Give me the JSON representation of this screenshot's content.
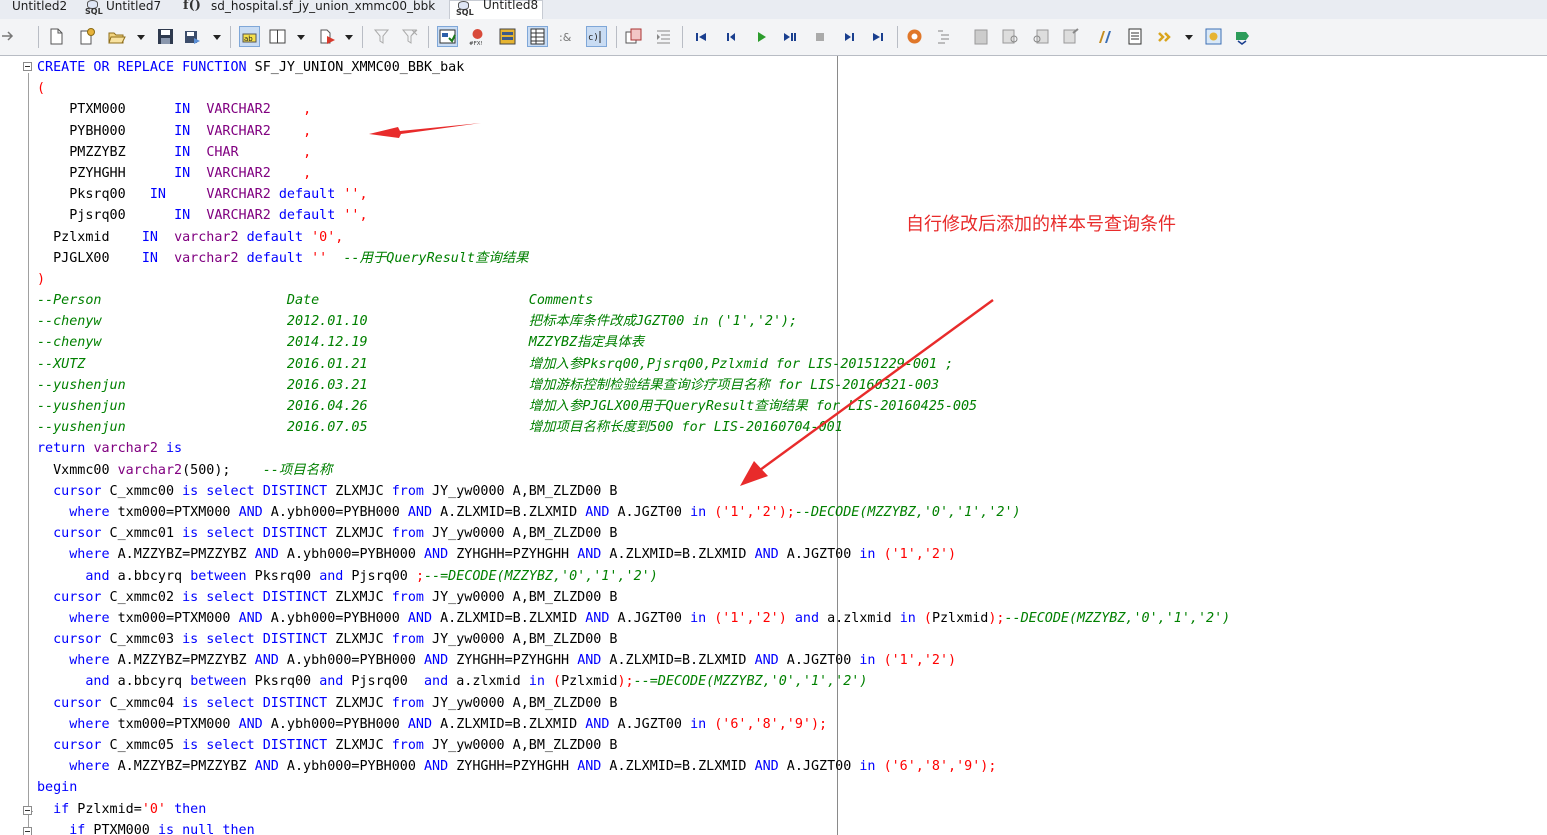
{
  "tabs": [
    {
      "label": "Untitled2",
      "icon": "untitled-tab-icon"
    },
    {
      "label": "Untitled7",
      "icon": "sql-file-icon",
      "icon_text": "SQL"
    },
    {
      "label": "sd_hospital.sf_jy_union_xmmc00_bbk",
      "icon": "function-icon",
      "icon_text": "f()"
    },
    {
      "label": "Untitled8",
      "icon": "sql-file-icon",
      "icon_text": "SQL",
      "active": true
    }
  ],
  "toolbar_icons": [
    "back-arrow-icon",
    "new-file-icon",
    "new-with-template-icon",
    "open-file-icon",
    "save-icon",
    "save-as-icon",
    "text-highlight-icon",
    "split-view-icon",
    "run-menu-icon",
    "filter-icon",
    "filter-clear-icon",
    "autocommit-icon",
    "debug-icon",
    "grid-icon",
    "table-icon",
    "and-icon",
    "step-icon",
    "copy-icon",
    "indent-icon",
    "first-record-icon",
    "prev-record-icon",
    "play-icon",
    "next-icon",
    "stop-icon",
    "step-into-icon",
    "last-record-icon",
    "execute-icon",
    "outline-icon",
    "print-preview-icon",
    "find-icon",
    "find-next-icon",
    "compile-icon",
    "beautify-icon",
    "window-list-icon",
    "more-options-icon",
    "plan-icon",
    "commit-icon"
  ],
  "editor": {
    "lines": [
      [
        [
          "k",
          "CREATE OR REPLACE FUNCTION"
        ],
        [
          "x",
          " SF_JY_UNION_XMMC00_BBK_bak"
        ]
      ],
      [
        [
          "p",
          "("
        ]
      ],
      [
        [
          "x",
          "    PTXM000      "
        ],
        [
          "k",
          "IN"
        ],
        [
          "x",
          "  "
        ],
        [
          "t",
          "VARCHAR2"
        ],
        [
          "x",
          "    "
        ],
        [
          "s",
          ","
        ]
      ],
      [
        [
          "x",
          "    PYBH000      "
        ],
        [
          "k",
          "IN"
        ],
        [
          "x",
          "  "
        ],
        [
          "t",
          "VARCHAR2"
        ],
        [
          "x",
          "    "
        ],
        [
          "s",
          ","
        ]
      ],
      [
        [
          "x",
          "    PMZZYBZ      "
        ],
        [
          "k",
          "IN"
        ],
        [
          "x",
          "  "
        ],
        [
          "t",
          "CHAR"
        ],
        [
          "x",
          "        "
        ],
        [
          "s",
          ","
        ]
      ],
      [
        [
          "x",
          "    PZYHGHH      "
        ],
        [
          "k",
          "IN"
        ],
        [
          "x",
          "  "
        ],
        [
          "t",
          "VARCHAR2"
        ],
        [
          "x",
          "    "
        ],
        [
          "s",
          ","
        ]
      ],
      [
        [
          "x",
          "    Pksrq00   "
        ],
        [
          "k",
          "IN"
        ],
        [
          "x",
          "     "
        ],
        [
          "t",
          "VARCHAR2"
        ],
        [
          "x",
          " "
        ],
        [
          "k",
          "default"
        ],
        [
          "x",
          " "
        ],
        [
          "s",
          "'',"
        ]
      ],
      [
        [
          "x",
          "    Pjsrq00      "
        ],
        [
          "k",
          "IN"
        ],
        [
          "x",
          "  "
        ],
        [
          "t",
          "VARCHAR2"
        ],
        [
          "x",
          " "
        ],
        [
          "k",
          "default"
        ],
        [
          "x",
          " "
        ],
        [
          "s",
          "'',"
        ]
      ],
      [
        [
          "x",
          "  Pzlxmid    "
        ],
        [
          "k",
          "IN"
        ],
        [
          "x",
          "  "
        ],
        [
          "t",
          "varchar2"
        ],
        [
          "x",
          " "
        ],
        [
          "k",
          "default"
        ],
        [
          "x",
          " "
        ],
        [
          "s",
          "'0',"
        ]
      ],
      [
        [
          "x",
          "  PJGLX00    "
        ],
        [
          "k",
          "IN"
        ],
        [
          "x",
          "  "
        ],
        [
          "t",
          "varchar2"
        ],
        [
          "x",
          " "
        ],
        [
          "k",
          "default"
        ],
        [
          "x",
          " "
        ],
        [
          "s",
          "''"
        ],
        [
          "x",
          "  "
        ],
        [
          "c",
          "--用于QueryResult查询结果"
        ]
      ],
      [
        [
          "p",
          ")"
        ]
      ],
      [
        [
          "c",
          "--Person                       Date                          Comments"
        ]
      ],
      [
        [
          "c",
          "--chenyw                       2012.01.10                    把标本库条件改成JGZT00 in ('1','2');"
        ]
      ],
      [
        [
          "c",
          "--chenyw                       2014.12.19                    MZZYBZ指定具体表"
        ]
      ],
      [
        [
          "c",
          "--XUTZ                         2016.01.21                    增加入参Pksrq00,Pjsrq00,Pzlxmid for LIS-20151229-001 ;"
        ]
      ],
      [
        [
          "c",
          "--yushenjun                    2016.03.21                    增加游标控制检验结果查询诊疗项目名称 for LIS-20160321-003"
        ]
      ],
      [
        [
          "c",
          "--yushenjun                    2016.04.26                    增加入参PJGLX00用于QueryResult查询结果 for LIS-20160425-005"
        ]
      ],
      [
        [
          "c",
          "--yushenjun                    2016.07.05                    增加项目名称长度到500 for LIS-20160704-001"
        ]
      ],
      [
        [
          "k",
          "return"
        ],
        [
          "x",
          " "
        ],
        [
          "t",
          "varchar2"
        ],
        [
          "x",
          " "
        ],
        [
          "k",
          "is"
        ]
      ],
      [
        [
          "x",
          "  Vxmmc00 "
        ],
        [
          "t",
          "varchar2"
        ],
        [
          "x",
          "(500);    "
        ],
        [
          "c",
          "--项目名称"
        ]
      ],
      [
        [
          "x",
          "  "
        ],
        [
          "k",
          "cursor"
        ],
        [
          "x",
          " C_xmmc00 "
        ],
        [
          "k",
          "is select DISTINCT"
        ],
        [
          "x",
          " ZLXMJC "
        ],
        [
          "k",
          "from"
        ],
        [
          "x",
          " JY_yw0000 A,BM_ZLZD00 B"
        ]
      ],
      [
        [
          "x",
          "    "
        ],
        [
          "k",
          "where"
        ],
        [
          "x",
          " txm000=PTXM000 "
        ],
        [
          "k",
          "AND"
        ],
        [
          "x",
          " A.ybh000=PYBH000 "
        ],
        [
          "k",
          "AND"
        ],
        [
          "x",
          " A.ZLXMID=B.ZLXMID "
        ],
        [
          "k",
          "AND"
        ],
        [
          "x",
          " A.JGZT00 "
        ],
        [
          "k",
          "in"
        ],
        [
          "x",
          " "
        ],
        [
          "s",
          "('1','2');"
        ],
        [
          "c",
          "--DECODE(MZZYBZ,'0','1','2')"
        ]
      ],
      [
        [
          "x",
          "  "
        ],
        [
          "k",
          "cursor"
        ],
        [
          "x",
          " C_xmmc01 "
        ],
        [
          "k",
          "is select DISTINCT"
        ],
        [
          "x",
          " ZLXMJC "
        ],
        [
          "k",
          "from"
        ],
        [
          "x",
          " JY_yw0000 A,BM_ZLZD00 B"
        ]
      ],
      [
        [
          "x",
          "    "
        ],
        [
          "k",
          "where"
        ],
        [
          "x",
          " A.MZZYBZ=PMZZYBZ "
        ],
        [
          "k",
          "AND"
        ],
        [
          "x",
          " A.ybh000=PYBH000 "
        ],
        [
          "k",
          "AND"
        ],
        [
          "x",
          " ZYHGHH=PZYHGHH "
        ],
        [
          "k",
          "AND"
        ],
        [
          "x",
          " A.ZLXMID=B.ZLXMID "
        ],
        [
          "k",
          "AND"
        ],
        [
          "x",
          " A.JGZT00 "
        ],
        [
          "k",
          "in"
        ],
        [
          "x",
          " "
        ],
        [
          "s",
          "('1','2')"
        ]
      ],
      [
        [
          "x",
          "      "
        ],
        [
          "k",
          "and"
        ],
        [
          "x",
          " a.bbcyrq "
        ],
        [
          "k",
          "between"
        ],
        [
          "x",
          " Pksrq00 "
        ],
        [
          "k",
          "and"
        ],
        [
          "x",
          " Pjsrq00 "
        ],
        [
          "s",
          ";"
        ],
        [
          "c",
          "--=DECODE(MZZYBZ,'0','1','2')"
        ]
      ],
      [
        [
          "x",
          "  "
        ],
        [
          "k",
          "cursor"
        ],
        [
          "x",
          " C_xmmc02 "
        ],
        [
          "k",
          "is select DISTINCT"
        ],
        [
          "x",
          " ZLXMJC "
        ],
        [
          "k",
          "from"
        ],
        [
          "x",
          " JY_yw0000 A,BM_ZLZD00 B"
        ]
      ],
      [
        [
          "x",
          "    "
        ],
        [
          "k",
          "where"
        ],
        [
          "x",
          " txm000=PTXM000 "
        ],
        [
          "k",
          "AND"
        ],
        [
          "x",
          " A.ybh000=PYBH000 "
        ],
        [
          "k",
          "AND"
        ],
        [
          "x",
          " A.ZLXMID=B.ZLXMID "
        ],
        [
          "k",
          "AND"
        ],
        [
          "x",
          " A.JGZT00 "
        ],
        [
          "k",
          "in"
        ],
        [
          "x",
          " "
        ],
        [
          "s",
          "('1','2')"
        ],
        [
          "x",
          " "
        ],
        [
          "k",
          "and"
        ],
        [
          "x",
          " a.zlxmid "
        ],
        [
          "k",
          "in"
        ],
        [
          "x",
          " "
        ],
        [
          "s",
          "("
        ],
        [
          "x",
          "Pzlxmid"
        ],
        [
          "s",
          ");"
        ],
        [
          "c",
          "--DECODE(MZZYBZ,'0','1','2')"
        ]
      ],
      [
        [
          "x",
          "  "
        ],
        [
          "k",
          "cursor"
        ],
        [
          "x",
          " C_xmmc03 "
        ],
        [
          "k",
          "is select DISTINCT"
        ],
        [
          "x",
          " ZLXMJC "
        ],
        [
          "k",
          "from"
        ],
        [
          "x",
          " JY_yw0000 A,BM_ZLZD00 B"
        ]
      ],
      [
        [
          "x",
          "    "
        ],
        [
          "k",
          "where"
        ],
        [
          "x",
          " A.MZZYBZ=PMZZYBZ "
        ],
        [
          "k",
          "AND"
        ],
        [
          "x",
          " A.ybh000=PYBH000 "
        ],
        [
          "k",
          "AND"
        ],
        [
          "x",
          " ZYHGHH=PZYHGHH "
        ],
        [
          "k",
          "AND"
        ],
        [
          "x",
          " A.ZLXMID=B.ZLXMID "
        ],
        [
          "k",
          "AND"
        ],
        [
          "x",
          " A.JGZT00 "
        ],
        [
          "k",
          "in"
        ],
        [
          "x",
          " "
        ],
        [
          "s",
          "('1','2')"
        ]
      ],
      [
        [
          "x",
          "      "
        ],
        [
          "k",
          "and"
        ],
        [
          "x",
          " a.bbcyrq "
        ],
        [
          "k",
          "between"
        ],
        [
          "x",
          " Pksrq00 "
        ],
        [
          "k",
          "and"
        ],
        [
          "x",
          " Pjsrq00  "
        ],
        [
          "k",
          "and"
        ],
        [
          "x",
          " a.zlxmid "
        ],
        [
          "k",
          "in"
        ],
        [
          "x",
          " "
        ],
        [
          "s",
          "("
        ],
        [
          "x",
          "Pzlxmid"
        ],
        [
          "s",
          ");"
        ],
        [
          "c",
          "--=DECODE(MZZYBZ,'0','1','2')"
        ]
      ],
      [
        [
          "x",
          "  "
        ],
        [
          "k",
          "cursor"
        ],
        [
          "x",
          " C_xmmc04 "
        ],
        [
          "k",
          "is select DISTINCT"
        ],
        [
          "x",
          " ZLXMJC "
        ],
        [
          "k",
          "from"
        ],
        [
          "x",
          " JY_yw0000 A,BM_ZLZD00 B"
        ]
      ],
      [
        [
          "x",
          "    "
        ],
        [
          "k",
          "where"
        ],
        [
          "x",
          " txm000=PTXM000 "
        ],
        [
          "k",
          "AND"
        ],
        [
          "x",
          " A.ybh000=PYBH000 "
        ],
        [
          "k",
          "AND"
        ],
        [
          "x",
          " A.ZLXMID=B.ZLXMID "
        ],
        [
          "k",
          "AND"
        ],
        [
          "x",
          " A.JGZT00 "
        ],
        [
          "k",
          "in"
        ],
        [
          "x",
          " "
        ],
        [
          "s",
          "('6','8','9');"
        ]
      ],
      [
        [
          "x",
          "  "
        ],
        [
          "k",
          "cursor"
        ],
        [
          "x",
          " C_xmmc05 "
        ],
        [
          "k",
          "is select DISTINCT"
        ],
        [
          "x",
          " ZLXMJC "
        ],
        [
          "k",
          "from"
        ],
        [
          "x",
          " JY_yw0000 A,BM_ZLZD00 B"
        ]
      ],
      [
        [
          "x",
          "    "
        ],
        [
          "k",
          "where"
        ],
        [
          "x",
          " A.MZZYBZ=PMZZYBZ "
        ],
        [
          "k",
          "AND"
        ],
        [
          "x",
          " A.ybh000=PYBH000 "
        ],
        [
          "k",
          "AND"
        ],
        [
          "x",
          " ZYHGHH=PZYHGHH "
        ],
        [
          "k",
          "AND"
        ],
        [
          "x",
          " A.ZLXMID=B.ZLXMID "
        ],
        [
          "k",
          "AND"
        ],
        [
          "x",
          " A.JGZT00 "
        ],
        [
          "k",
          "in"
        ],
        [
          "x",
          " "
        ],
        [
          "s",
          "('6','8','9');"
        ]
      ],
      [
        [
          "k",
          "begin"
        ]
      ],
      [
        [
          "x",
          "  "
        ],
        [
          "k",
          "if"
        ],
        [
          "x",
          " Pzlxmid="
        ],
        [
          "s",
          "'0'"
        ],
        [
          "x",
          " "
        ],
        [
          "k",
          "then"
        ]
      ],
      [
        [
          "x",
          "    "
        ],
        [
          "k",
          "if"
        ],
        [
          "x",
          " PTXM000 "
        ],
        [
          "k",
          "is null then"
        ]
      ]
    ]
  },
  "annotation": {
    "text": "自行修改后添加的样本号查询条件",
    "color": "#e82b2b"
  }
}
